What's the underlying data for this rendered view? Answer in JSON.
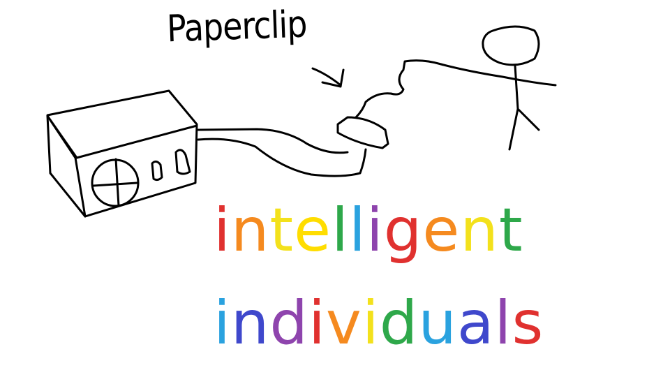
{
  "sketch": {
    "label": "Paperclip",
    "stroke_color": "#000000"
  },
  "words": [
    {
      "text": "intelligent",
      "letter_colors": [
        "#e0312f",
        "#f58a1f",
        "#f3e11c",
        "#ffdd00",
        "#2ea84a",
        "#2aa2df",
        "#8e44ad",
        "#e0312f",
        "#f58a1f",
        "#f3e11c",
        "#2ea84a"
      ]
    },
    {
      "text": "individuals",
      "letter_colors": [
        "#2aa2df",
        "#3f48cc",
        "#8e44ad",
        "#e0312f",
        "#f58a1f",
        "#f3e11c",
        "#2ea84a",
        "#2aa2df",
        "#3f48cc",
        "#8e44ad",
        "#e0312f"
      ]
    }
  ],
  "palette": {
    "red": "#e0312f",
    "orange": "#f58a1f",
    "yellow": "#f3e11c",
    "green": "#2ea84a",
    "blue": "#2aa2df",
    "indigo": "#3f48cc",
    "violet": "#8e44ad"
  }
}
